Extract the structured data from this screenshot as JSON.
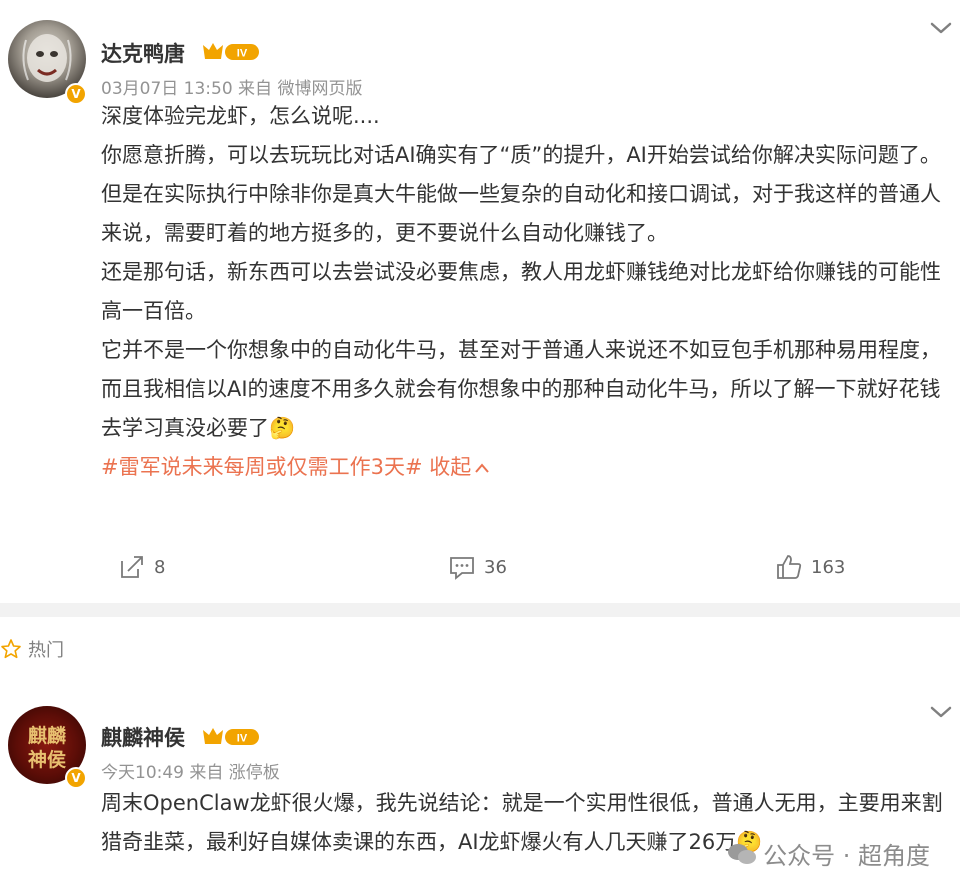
{
  "post1": {
    "username": "达克鸭唐",
    "level": "IV",
    "meta": "03月07日 13:50  来自 微博网页版",
    "paragraphs": [
      "深度体验完龙虾，怎么说呢....",
      "你愿意折腾，可以去玩玩比对话AI确实有了“质”的提升，AI开始尝试给你解决实际问题了。",
      "但是在实际执行中除非你是真大牛能做一些复杂的自动化和接口调试，对于我这样的普通人来说，需要盯着的地方挺多的，更不要说什么自动化赚钱了。",
      "还是那句话，新东西可以去尝试没必要焦虑，教人用龙虾赚钱绝对比龙虾给你赚钱的可能性高一百倍。",
      "它并不是一个你想象中的自动化牛马，甚至对于普通人来说还不如豆包手机那种易用程度，而且我相信以AI的速度不用多久就会有你想象中的那种自动化牛马，所以了解一下就好花钱去学习真没必要了"
    ],
    "emoji": "🤔",
    "hashtag": "#雷军说未来每周或仅需工作3天#",
    "collapse_label": "收起",
    "repost_count": "8",
    "comment_count": "36",
    "like_count": "163"
  },
  "hot_label": "热门",
  "post2": {
    "username": "麒麟神侯",
    "level": "IV",
    "meta": "今天10:49  来自 涨停板",
    "text": "周末OpenClaw龙虾很火爆，我先说结论：就是一个实用性很低，普通人无用，主要用来割猎奇韭菜，最利好自媒体卖课的东西，AI龙虾爆火有人几天赚了26万",
    "emoji": "🤔",
    "avatar_text_1": "麒麟",
    "avatar_text_2": "神侯"
  },
  "watermark": {
    "label": "公众号 · 超角度"
  },
  "colors": {
    "accent": "#eb7350",
    "badge": "#f2a400",
    "meta": "#939393"
  }
}
